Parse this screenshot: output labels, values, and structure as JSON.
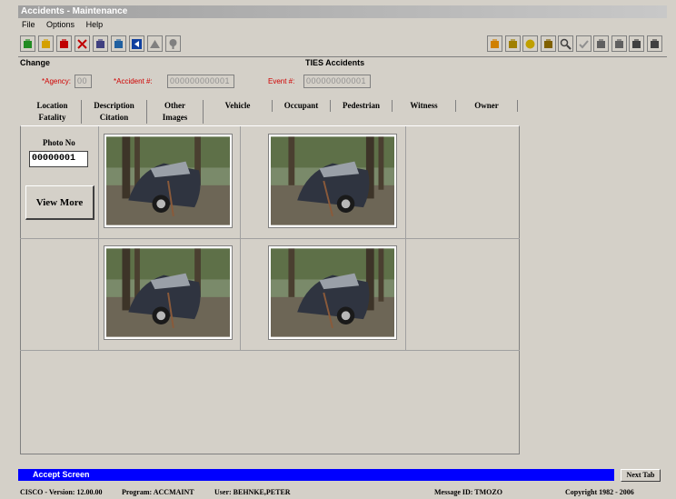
{
  "window": {
    "title": "Accidents - Maintenance"
  },
  "menu": [
    "File",
    "Options",
    "Help"
  ],
  "toolbar_left": [
    {
      "name": "open-icon",
      "color": "#228b22"
    },
    {
      "name": "folder-icon",
      "color": "#d4a000"
    },
    {
      "name": "save-icon",
      "color": "#c00000"
    },
    {
      "name": "delete-icon",
      "color": "#c00000"
    },
    {
      "name": "print-icon",
      "color": "#404080"
    },
    {
      "name": "calculator-icon",
      "color": "#2060a0"
    },
    {
      "name": "navigate-icon",
      "color": "#1040a0"
    },
    {
      "name": "up-icon",
      "color": "#808080"
    },
    {
      "name": "down-icon",
      "color": "#808080"
    }
  ],
  "toolbar_right": [
    {
      "name": "pencil-icon",
      "color": "#d08000"
    },
    {
      "name": "notepad-icon",
      "color": "#a08000"
    },
    {
      "name": "globe-icon",
      "color": "#c0a000"
    },
    {
      "name": "chart-icon",
      "color": "#806000"
    },
    {
      "name": "magnifier-icon",
      "color": "#404040"
    },
    {
      "name": "checkmark-icon",
      "color": "#909090"
    },
    {
      "name": "disk-icon",
      "color": "#606060"
    },
    {
      "name": "recycle-icon",
      "color": "#606060"
    },
    {
      "name": "camera-icon",
      "color": "#404040"
    },
    {
      "name": "exit-icon",
      "color": "#404040"
    }
  ],
  "header": {
    "mode": "Change",
    "title": "TIES Accidents"
  },
  "keys": {
    "agency_label": "*Agency:",
    "agency_value": "00",
    "accident_label": "*Accident #:",
    "accident_value": "000000000001",
    "event_label": "Event #:",
    "event_value": "000000000001"
  },
  "tabs_row1": [
    "Location",
    "Description",
    "Other",
    "Vehicle",
    "Occupant",
    "Pedestrian",
    "Witness",
    "Owner"
  ],
  "tabs_row2": [
    "Fatality",
    "Citation",
    "Images"
  ],
  "active_tab": "Images",
  "photo": {
    "label": "Photo No",
    "value": "00000001",
    "view_more": "View More"
  },
  "status": {
    "accept": "Accept Screen",
    "next_tab": "Next Tab",
    "version": "CISCO - Version: 12.00.00",
    "program": "Program: ACCMAINT",
    "user": "User: BEHNKE,PETER",
    "message": "Message ID: TMOZO",
    "copyright": "Copyright 1982 - 2006"
  },
  "colors": {
    "accent_bar": "#0000ff",
    "required_label": "#d00000"
  }
}
